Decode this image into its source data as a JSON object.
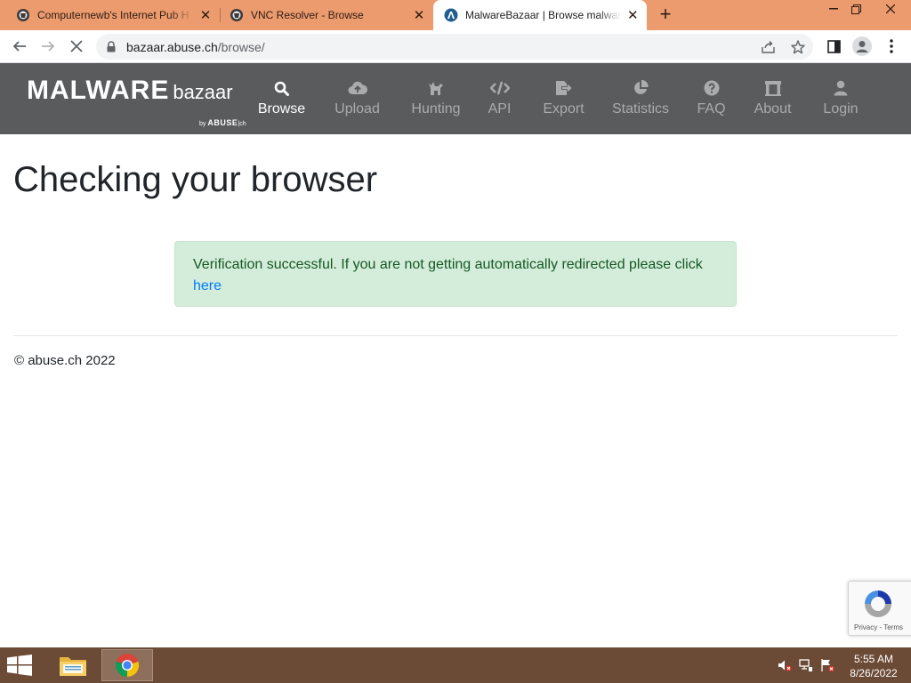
{
  "browser": {
    "tabs": [
      {
        "title": "Computernewb's Internet Pub H",
        "icon": "computernewb-favicon-icon"
      },
      {
        "title": "VNC Resolver - Browse",
        "icon": "computernewb-favicon-icon"
      },
      {
        "title": "MalwareBazaar | Browse malware",
        "icon": "malwarebazaar-favicon-icon"
      }
    ],
    "active_tab_index": 2,
    "url_host": "bazaar.abuse.ch",
    "url_path": "/browse/",
    "colors": {
      "tabstrip": "#ec9b6e",
      "omnibox": "#f1f3f4"
    }
  },
  "site": {
    "brand_main": "MALWARE",
    "brand_sub": "bazaar",
    "brand_by": "by",
    "brand_org": "ABUSE",
    "brand_org_suffix": "|ch",
    "nav": [
      {
        "label": "Browse",
        "icon": "search-icon",
        "active": true
      },
      {
        "label": "Upload",
        "icon": "cloud-upload-icon",
        "active": false
      },
      {
        "label": "Hunting",
        "icon": "hunting-icon",
        "active": false
      },
      {
        "label": "API",
        "icon": "code-icon",
        "active": false
      },
      {
        "label": "Export",
        "icon": "export-icon",
        "active": false
      },
      {
        "label": "Statistics",
        "icon": "pie-chart-icon",
        "active": false
      },
      {
        "label": "FAQ",
        "icon": "question-icon",
        "active": false
      },
      {
        "label": "About",
        "icon": "building-icon",
        "active": false
      },
      {
        "label": "Login",
        "icon": "user-icon",
        "active": false
      }
    ],
    "colors": {
      "navbar": "#595b5d",
      "alert_bg": "#d4edda",
      "alert_text": "#155724",
      "link": "#007bff"
    }
  },
  "content": {
    "heading": "Checking your browser",
    "alert_text": "Verification successful. If you are not getting automatically redirected please click",
    "alert_link": "here",
    "footer": "© abuse.ch 2022"
  },
  "recaptcha": {
    "privacy": "Privacy",
    "sep": " - ",
    "terms": "Terms"
  },
  "taskbar": {
    "apps": [
      {
        "name": "file-explorer-icon",
        "active": false
      },
      {
        "name": "chrome-icon",
        "active": true
      }
    ],
    "time": "5:55 AM",
    "date": "8/26/2022"
  }
}
